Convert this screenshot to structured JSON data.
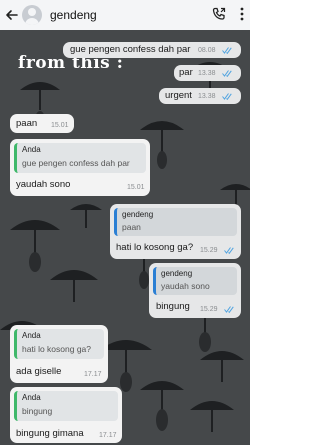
{
  "header": {
    "contact_name": "gendeng",
    "back_icon": "arrow-left-icon",
    "call_icon": "phone-call-icon",
    "menu_icon": "more-vertical-icon",
    "background_color": "#f4f5f7"
  },
  "overlay_text": "from this :",
  "messages": [
    {
      "direction": "out",
      "text": "gue pengen confess dah par",
      "time": "08.08",
      "read": true
    },
    {
      "direction": "out",
      "text": "par",
      "time": "13.38",
      "read": true
    },
    {
      "direction": "out",
      "text": "urgent",
      "time": "13.38",
      "read": true
    },
    {
      "direction": "in",
      "text": "paan",
      "time": "15.01"
    },
    {
      "direction": "in",
      "quote_name": "Anda",
      "quote_text": "gue pengen confess dah par",
      "text": "yaudah sono",
      "time": "15.01"
    },
    {
      "direction": "out",
      "quote_name": "gendeng",
      "quote_text": "paan",
      "text": "hati lo kosong ga?",
      "time": "15.29",
      "read": true
    },
    {
      "direction": "out",
      "quote_name": "gendeng",
      "quote_text": "yaudah sono",
      "text": "bingung",
      "time": "15.29",
      "read": true
    },
    {
      "direction": "in",
      "quote_name": "Anda",
      "quote_text": "hati lo kosong ga?",
      "text": "ada giselle",
      "time": "17.17"
    },
    {
      "direction": "in",
      "quote_name": "Anda",
      "quote_text": "bingung",
      "text": "bingung gimana",
      "time": "17.17"
    }
  ],
  "colors": {
    "chat_background": "#3b3e40",
    "outgoing_bubble": "#e6e7e8",
    "incoming_bubble": "#f3f3f3",
    "read_ticks": "#4fa3e0",
    "quote_bar_incoming": "#3fb86a",
    "quote_bar_outgoing": "#2a7fd4"
  }
}
